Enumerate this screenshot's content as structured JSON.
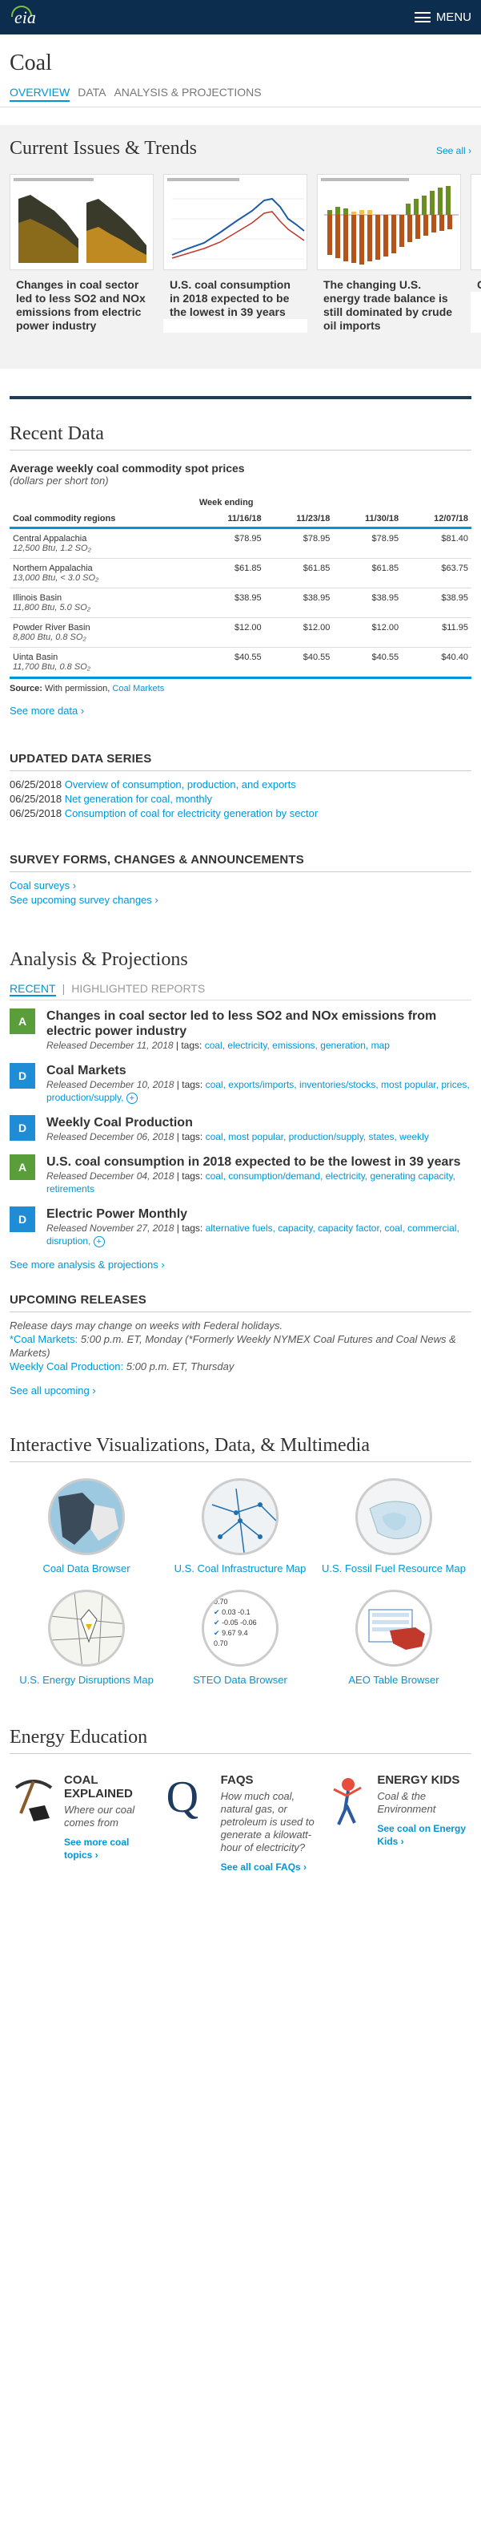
{
  "header": {
    "logo_text": "eia",
    "menu_label": "MENU"
  },
  "page_title": "Coal",
  "subnav": [
    "OVERVIEW",
    "DATA",
    "ANALYSIS & PROJECTIONS"
  ],
  "trends": {
    "heading": "Current Issues & Trends",
    "see_all": "See all ›",
    "cards": [
      {
        "text": "Changes in coal sector led to less SO2 and NOx emissions from electric power industry"
      },
      {
        "text": "U.S. coal consumption in 2018 expected to be the lowest in 39 years"
      },
      {
        "text": "The changing U.S. energy trade balance is still dominated by crude oil imports"
      },
      {
        "text": "C"
      }
    ]
  },
  "recent_data": {
    "heading": "Recent Data",
    "table_title": "Average weekly coal commodity spot prices",
    "table_subtitle": "(dollars per short ton)",
    "group_header": "Week ending",
    "columns": [
      "Coal commodity regions",
      "11/16/18",
      "11/23/18",
      "11/30/18",
      "12/07/18"
    ],
    "rows": [
      {
        "region": "Central Appalachia",
        "spec": "12,500 Btu, 1.2 SO₂",
        "values": [
          "$78.95",
          "$78.95",
          "$78.95",
          "$81.40"
        ]
      },
      {
        "region": "Northern Appalachia",
        "spec": "13,000 Btu, < 3.0 SO₂",
        "values": [
          "$61.85",
          "$61.85",
          "$61.85",
          "$63.75"
        ]
      },
      {
        "region": "Illinois Basin",
        "spec": "11,800 Btu, 5.0 SO₂",
        "values": [
          "$38.95",
          "$38.95",
          "$38.95",
          "$38.95"
        ]
      },
      {
        "region": "Powder River Basin",
        "spec": "8,800 Btu, 0.8 SO₂",
        "values": [
          "$12.00",
          "$12.00",
          "$12.00",
          "$11.95"
        ]
      },
      {
        "region": "Uinta Basin",
        "spec": "11,700 Btu, 0.8 SO₂",
        "values": [
          "$40.55",
          "$40.55",
          "$40.55",
          "$40.40"
        ]
      }
    ],
    "source_label": "Source:",
    "source_text": "With permission,",
    "source_link": "Coal Markets",
    "see_more": "See more data ›"
  },
  "updated_series": {
    "heading": "UPDATED DATA SERIES",
    "items": [
      {
        "date": "06/25/2018",
        "link": "Overview of consumption, production, and exports"
      },
      {
        "date": "06/25/2018",
        "link": "Net generation for coal, monthly"
      },
      {
        "date": "06/25/2018",
        "link": "Consumption of coal for electricity generation by sector"
      }
    ]
  },
  "survey": {
    "heading": "SURVEY FORMS, CHANGES & ANNOUNCEMENTS",
    "links": [
      "Coal surveys ›",
      "See upcoming survey changes ›"
    ]
  },
  "analysis": {
    "heading": "Analysis & Projections",
    "tabs": [
      "RECENT",
      "HIGHLIGHTED REPORTS"
    ],
    "reports": [
      {
        "badge": "A",
        "title": "Changes in coal sector led to less SO2 and NOx emissions from electric power industry",
        "released": "Released December 11, 2018",
        "tags": "coal, electricity, emissions, generation, map",
        "plus": false
      },
      {
        "badge": "D",
        "title": "Coal Markets",
        "released": "Released December 10, 2018",
        "tags": "coal, exports/imports, inventories/stocks, most popular, prices, production/supply,",
        "plus": true
      },
      {
        "badge": "D",
        "title": "Weekly Coal Production",
        "released": "Released December 06, 2018",
        "tags": "coal, most popular, production/supply, states, weekly",
        "plus": false
      },
      {
        "badge": "A",
        "title": "U.S. coal consumption in 2018 expected to be the lowest in 39 years",
        "released": "Released December 04, 2018",
        "tags": "coal, consumption/demand, electricity, generating capacity, retirements",
        "plus": false
      },
      {
        "badge": "D",
        "title": "Electric Power Monthly",
        "released": "Released November 27, 2018",
        "tags": "alternative fuels, capacity, capacity factor, coal, commercial, disruption,",
        "plus": true
      }
    ],
    "tags_label": "tags:",
    "see_more": "See more analysis & projections ›"
  },
  "upcoming": {
    "heading": "UPCOMING RELEASES",
    "note": "Release days may change on weeks with Federal holidays.",
    "item1_link": "*Coal Markets:",
    "item1_text": "5:00 p.m. ET, Monday (*Formerly Weekly NYMEX Coal Futures and Coal News & Markets)",
    "item2_link": "Weekly Coal Production:",
    "item2_text": "5:00 p.m. ET, Thursday",
    "see_all": "See all upcoming ›"
  },
  "viz": {
    "heading": "Interactive Visualizations, Data, & Multimedia",
    "items": [
      "Coal Data Browser",
      "U.S. Coal Infrastructure Map",
      "U.S. Fossil Fuel Resource Map",
      "U.S. Energy Disruptions Map",
      "STEO Data Browser",
      "AEO Table Browser"
    ],
    "steo_values": [
      "0.70",
      "0.03",
      "-0.1",
      "-0.05",
      "-0.06",
      "9.67",
      "9.4",
      "0.70"
    ]
  },
  "education": {
    "heading": "Energy Education",
    "items": [
      {
        "title": "COAL EXPLAINED",
        "desc": "Where our coal comes from",
        "link": "See more coal topics ›"
      },
      {
        "title": "FAQS",
        "desc": "How much coal, natural gas, or petroleum is used to generate a kilowatt-hour of electricity?",
        "link": "See all coal FAQs ›"
      },
      {
        "title": "ENERGY KIDS",
        "desc": "Coal & the Environment",
        "link": "See coal on Energy Kids ›"
      }
    ]
  }
}
